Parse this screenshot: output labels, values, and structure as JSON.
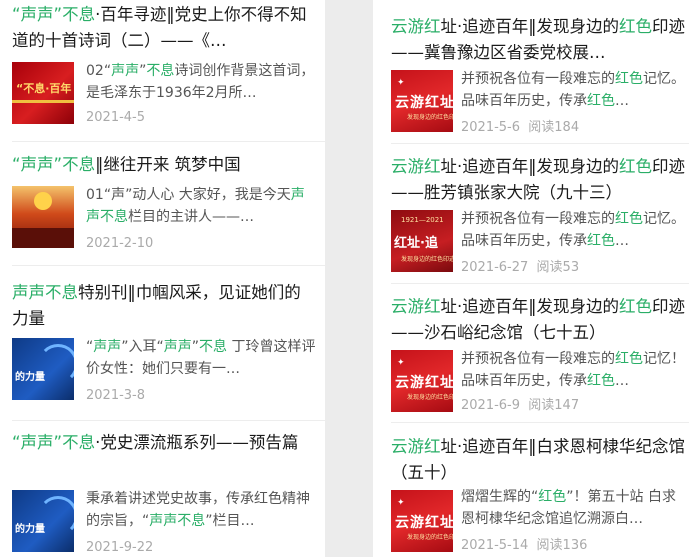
{
  "left_column": [
    {
      "title_parts": [
        [
          "g",
          "“声声”不息"
        ],
        [
          "k",
          "·百年寻迹‖党史上你不得不知道的十首诗词（二）——《…"
        ]
      ],
      "desc_parts": [
        [
          "k",
          "02“"
        ],
        [
          "g",
          "声声"
        ],
        [
          "k",
          "”"
        ],
        [
          "g",
          "不息"
        ],
        [
          "k",
          "诗词创作背景这首词，是毛泽东于1936年2月所…"
        ]
      ],
      "thumb_text": "“不息·百年",
      "date": "2021-4-5"
    },
    {
      "title_parts": [
        [
          "g",
          "“声声”不息"
        ],
        [
          "k",
          "‖继往开来 筑梦中国"
        ]
      ],
      "desc_parts": [
        [
          "k",
          "01“声”动人心 大家好，我是今天"
        ],
        [
          "g",
          "声声不息"
        ],
        [
          "k",
          "栏目的主讲人——…"
        ]
      ],
      "thumb_text": "",
      "date": "2021-2-10"
    },
    {
      "title_parts": [
        [
          "g",
          "声声不息"
        ],
        [
          "k",
          "特别刊‖巾帼风采，见证她们的力量"
        ]
      ],
      "desc_parts": [
        [
          "k",
          "“"
        ],
        [
          "g",
          "声声"
        ],
        [
          "k",
          "”入耳“"
        ],
        [
          "g",
          "声声"
        ],
        [
          "k",
          "”"
        ],
        [
          "g",
          "不息"
        ],
        [
          "k",
          " 丁玲曾这样评价女性：她们只要有一…"
        ]
      ],
      "thumb_text": "的力量",
      "date": "2021-3-8"
    },
    {
      "title_parts": [
        [
          "g",
          "“声声”不息"
        ],
        [
          "k",
          "·党史漂流瓶系列——预告篇"
        ]
      ],
      "desc_parts": [
        [
          "k",
          "秉承着讲述党史故事，传承红色精神的宗旨，“"
        ],
        [
          "g",
          "声声不息"
        ],
        [
          "k",
          "”栏目…"
        ]
      ],
      "thumb_text": "的力量",
      "date": "2021-9-22"
    }
  ],
  "right_column": [
    {
      "title_parts": [
        [
          "g",
          "云游红"
        ],
        [
          "k",
          "址·追迹百年‖发现身边的"
        ],
        [
          "g",
          "红色"
        ],
        [
          "k",
          "印迹——冀鲁豫边区省委党校展…"
        ]
      ],
      "desc_parts": [
        [
          "k",
          "并预祝各位有一段难忘的"
        ],
        [
          "r",
          "红色"
        ],
        [
          "k",
          "记忆。品味百年历史，传承"
        ],
        [
          "r",
          "红色"
        ],
        [
          "k",
          "…"
        ]
      ],
      "thumb_text": "云游红址",
      "thumb_sub": "发现身边的红色印迹",
      "date": "2021-5-6",
      "reads": "阅读184"
    },
    {
      "title_parts": [
        [
          "g",
          "云游红"
        ],
        [
          "k",
          "址·追迹百年‖发现身边的"
        ],
        [
          "g",
          "红色"
        ],
        [
          "k",
          "印迹——胜芳镇张家大院（九十三）"
        ]
      ],
      "desc_parts": [
        [
          "k",
          "并预祝各位有一段难忘的"
        ],
        [
          "r",
          "红色"
        ],
        [
          "k",
          "记忆。品味百年历史，传承"
        ],
        [
          "r",
          "红色"
        ],
        [
          "k",
          "…"
        ]
      ],
      "thumb_text": "红址·追",
      "thumb_year": "1921—2021",
      "thumb_sub": "发现身边的红色印迹",
      "date": "2021-6-27",
      "reads": "阅读53"
    },
    {
      "title_parts": [
        [
          "g",
          "云游红"
        ],
        [
          "k",
          "址·追迹百年‖发现身边的"
        ],
        [
          "g",
          "红色"
        ],
        [
          "k",
          "印迹——沙石峪纪念馆（七十五）"
        ]
      ],
      "desc_parts": [
        [
          "k",
          "并预祝各位有一段难忘的"
        ],
        [
          "r",
          "红色"
        ],
        [
          "k",
          "记忆！品味百年历史，传承"
        ],
        [
          "r",
          "红色"
        ],
        [
          "k",
          "…"
        ]
      ],
      "thumb_text": "云游红址",
      "thumb_sub": "发现身边的红色印迹",
      "date": "2021-6-9",
      "reads": "阅读147"
    },
    {
      "title_parts": [
        [
          "g",
          "云游红"
        ],
        [
          "k",
          "址·追迹百年‖白求恩柯棣华纪念馆（五十）"
        ]
      ],
      "desc_parts": [
        [
          "k",
          "熠熠生辉的“"
        ],
        [
          "r",
          "红色"
        ],
        [
          "k",
          "”！第五十站 白求恩柯棣华纪念馆追忆溯源白…"
        ]
      ],
      "thumb_text": "云游红址",
      "thumb_sub": "发现身边的红色印迹",
      "date": "2021-5-14",
      "reads": "阅读136"
    }
  ]
}
